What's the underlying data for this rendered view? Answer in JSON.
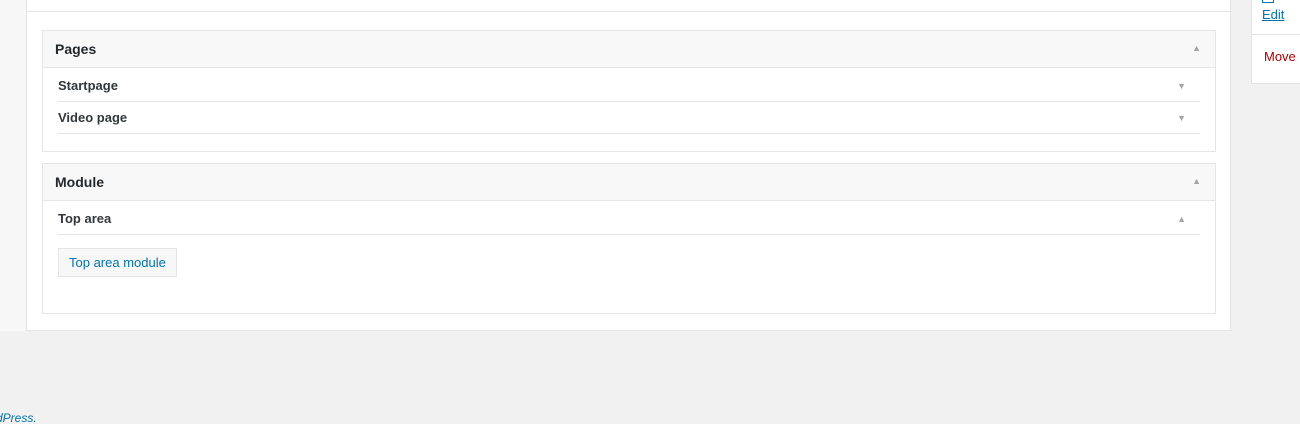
{
  "pages_box": {
    "title": "Pages",
    "items": [
      {
        "label": "Startpage"
      },
      {
        "label": "Video page"
      }
    ]
  },
  "module_box": {
    "title": "Module",
    "section": {
      "label": "Top area"
    },
    "button_label": "Top area module"
  },
  "sidebar": {
    "edit_label": "Edit",
    "move_label": "Move"
  },
  "footer": {
    "text": "dPress."
  },
  "icons": {
    "collapse": "triangle-up-icon",
    "expand": "triangle-down-icon"
  },
  "colors": {
    "link": "#0073aa",
    "danger": "#a00",
    "background": "#f1f1f1"
  }
}
